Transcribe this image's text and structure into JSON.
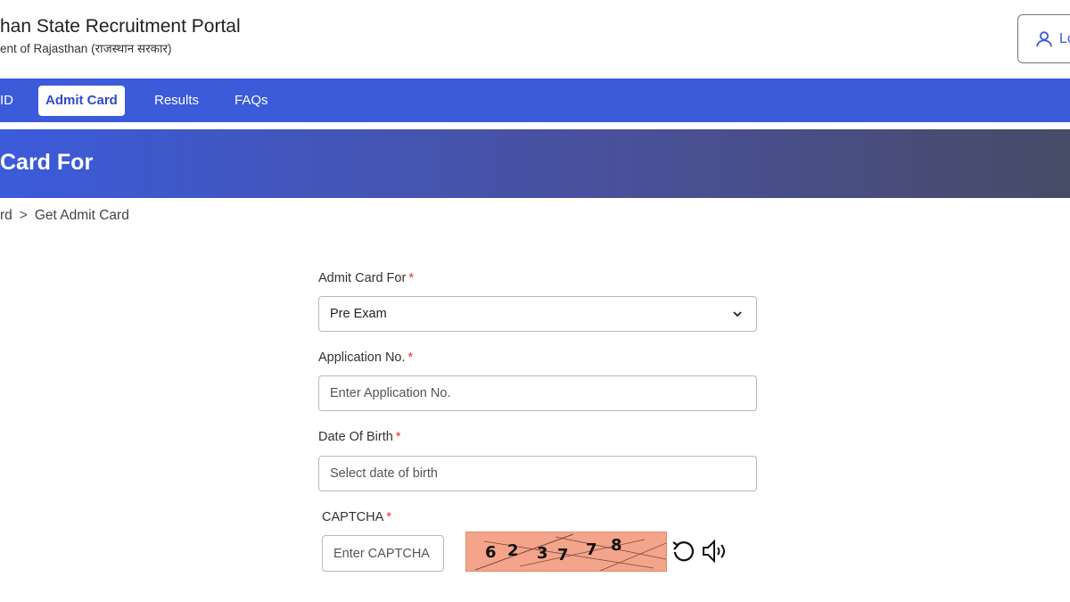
{
  "header": {
    "title": "han State Recruitment Portal",
    "subtitle": "ent of Rajasthan (राजस्थान सरकार)",
    "login_label": "Lo"
  },
  "nav": {
    "items": [
      {
        "label": "ID"
      },
      {
        "label": "Admit Card"
      },
      {
        "label": "Results"
      },
      {
        "label": "FAQs"
      }
    ],
    "active": "Admit Card"
  },
  "banner": {
    "title": "Card For"
  },
  "breadcrumb": {
    "items": [
      "rd",
      "Get Admit Card"
    ],
    "separator": ">"
  },
  "form": {
    "admit_card_for": {
      "label": "Admit Card For",
      "value": "Pre Exam"
    },
    "application_no": {
      "label": "Application No.",
      "placeholder": "Enter Application No."
    },
    "dob": {
      "label": "Date Of Birth",
      "placeholder": "Select date of birth"
    },
    "captcha": {
      "label": "CAPTCHA",
      "placeholder": "Enter CAPTCHA",
      "digits": [
        "6",
        "2",
        "3",
        "7",
        "7",
        "8"
      ]
    },
    "required_marker": "*"
  },
  "icons": {
    "user": "user-icon",
    "chevron": "chevron-down-icon",
    "refresh": "refresh-icon",
    "audio": "speaker-icon"
  },
  "colors": {
    "primary": "#3b5bdb",
    "required": "#e03131",
    "captcha_bg": "#f4a48a"
  }
}
